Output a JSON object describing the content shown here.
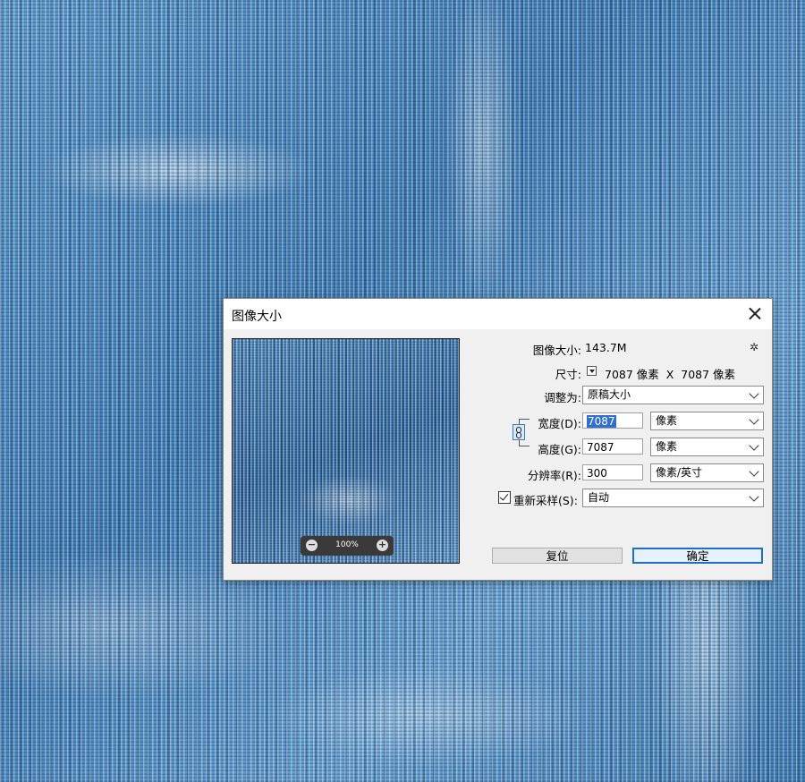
{
  "dialog": {
    "title": "图像大小",
    "image_size_label": "图像大小:",
    "image_size_value": "143.7M",
    "dimensions_label": "尺寸:",
    "dimensions_value": "7087 像素  X  7087 像素",
    "fit_to_label": "调整为:",
    "fit_to_value": "原稿大小",
    "width_label": "宽度(D):",
    "width_value": "7087",
    "width_unit": "像素",
    "height_label": "高度(G):",
    "height_value": "7087",
    "height_unit": "像素",
    "resolution_label": "分辨率(R):",
    "resolution_value": "300",
    "resolution_unit": "像素/英寸",
    "resample_label": "重新采样(S):",
    "resample_checked": true,
    "resample_value": "自动",
    "preview_zoom": "100%",
    "reset_button": "复位",
    "ok_button": "确定"
  },
  "colors": {
    "accent": "#1e6fc7",
    "selection": "#2f6fd0",
    "denim": "#4a86bb"
  },
  "icons": [
    "close-icon",
    "gear-icon",
    "zoom-out-icon",
    "zoom-in-icon",
    "link-icon",
    "chevron-down-icon",
    "check-icon"
  ]
}
